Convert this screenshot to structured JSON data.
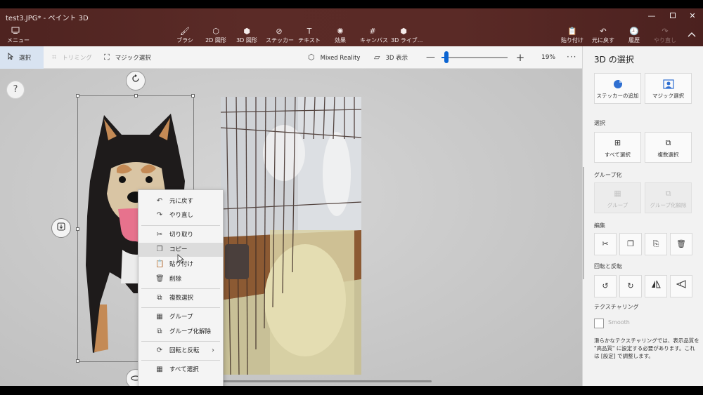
{
  "window": {
    "title": "test3.JPG* - ペイント 3D",
    "min_glyph": "—",
    "close_glyph": "✕"
  },
  "ribbon": {
    "menu_label": "メニュー",
    "tools": [
      {
        "label": "ブラシ",
        "icon": "brush-icon",
        "glyph": "🖌"
      },
      {
        "label": "2D 図形",
        "icon": "2d-shapes-icon",
        "glyph": "⬡"
      },
      {
        "label": "3D 図形",
        "icon": "3d-shapes-icon",
        "glyph": "⬢"
      },
      {
        "label": "ステッカー",
        "icon": "sticker-icon",
        "glyph": "⊘"
      },
      {
        "label": "テキスト",
        "icon": "text-icon",
        "glyph": "T"
      },
      {
        "label": "効果",
        "icon": "effects-icon",
        "glyph": "✺"
      },
      {
        "label": "キャンバス",
        "icon": "canvas-icon",
        "glyph": "#"
      },
      {
        "label": "3D ライブ...",
        "icon": "3d-library-icon",
        "glyph": "⬢"
      }
    ],
    "right_tools": [
      {
        "label": "貼り付け",
        "icon": "paste-icon",
        "glyph": "📋"
      },
      {
        "label": "元に戻す",
        "icon": "undo-icon",
        "glyph": "↶"
      },
      {
        "label": "履歴",
        "icon": "history-icon",
        "glyph": "🕘"
      },
      {
        "label": "やり直し",
        "icon": "redo-icon",
        "glyph": "↷"
      }
    ]
  },
  "commandbar": {
    "select": "選択",
    "crop": "トリミング",
    "magic_select": "マジック選択",
    "mixed_reality": "Mixed Reality",
    "view_3d": "3D 表示",
    "zoom_minus": "—",
    "zoom_plus": "+",
    "zoom_percent": "19%",
    "more": "···"
  },
  "canvas": {
    "help": "?"
  },
  "context_menu": {
    "items": [
      {
        "label": "元に戻す",
        "icon": "undo-icon",
        "glyph": "↶"
      },
      {
        "label": "やり直し",
        "icon": "redo-icon",
        "glyph": "↷"
      },
      {
        "label": "切り取り",
        "icon": "cut-icon",
        "glyph": "✂"
      },
      {
        "label": "コピー",
        "icon": "copy-icon",
        "glyph": "❐"
      },
      {
        "label": "貼り付け",
        "icon": "paste-icon",
        "glyph": "📋"
      },
      {
        "label": "削除",
        "icon": "delete-icon",
        "glyph": "🗑"
      },
      {
        "label": "複数選択",
        "icon": "multi-select-icon",
        "glyph": "⧉"
      },
      {
        "label": "グループ",
        "icon": "group-icon",
        "glyph": "▦"
      },
      {
        "label": "グループ化解除",
        "icon": "ungroup-icon",
        "glyph": "⧉"
      },
      {
        "label": "回転と反転",
        "icon": "rotate-flip-icon",
        "glyph": "⟳",
        "submenu_arrow": "›"
      },
      {
        "label": "すべて選択",
        "icon": "select-all-icon",
        "glyph": "▦"
      }
    ]
  },
  "panel": {
    "title": "3D の選択",
    "add_sticker": "ステッカーの追加",
    "magic_select": "マジック選択",
    "section_select": "選択",
    "select_all": "すべて選択",
    "multi_select": "複数選択",
    "section_group": "グループ化",
    "group": "グループ",
    "ungroup": "グループ化解除",
    "section_edit": "編集",
    "section_rotate": "回転と反転",
    "section_texture": "テクスチャリング",
    "smooth": "Smooth",
    "note": "滑らかなテクスチャリングでは、表示品質を \"高品質\" に設定する必要があります。これは [設定] で調整します。"
  }
}
